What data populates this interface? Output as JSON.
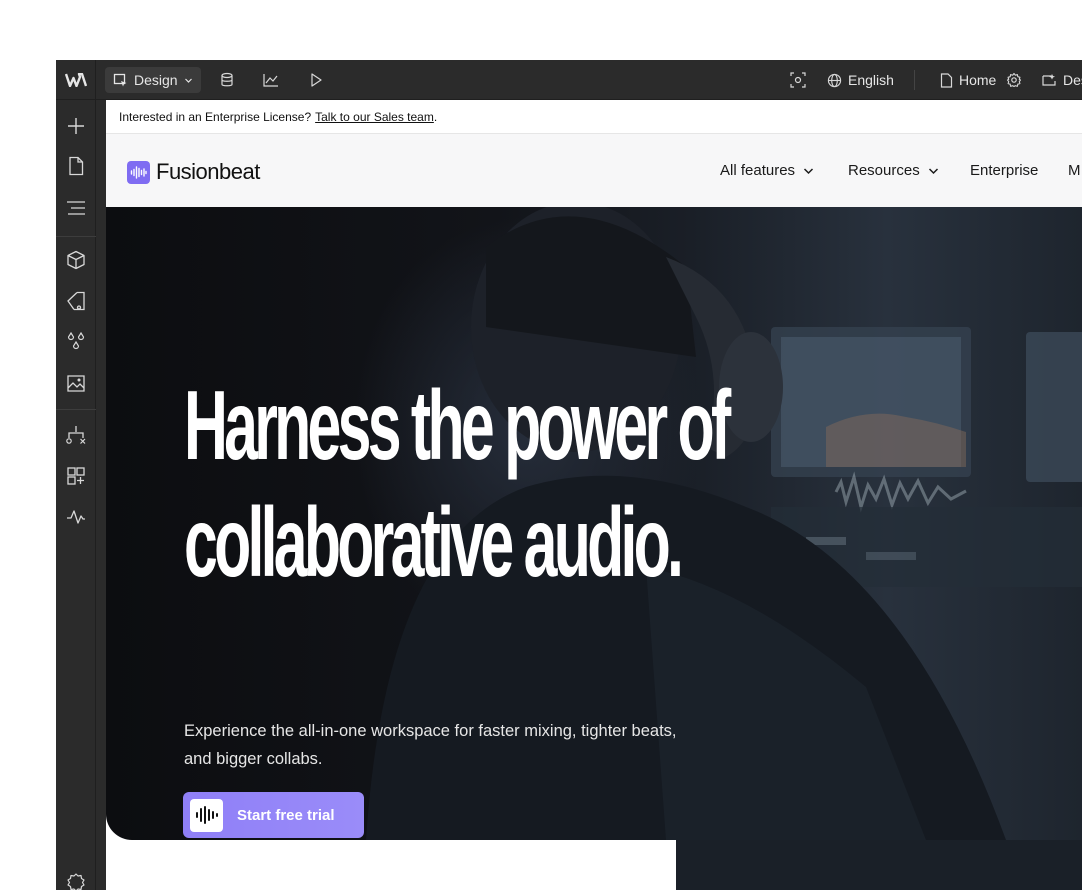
{
  "editor": {
    "mode_label": "Design",
    "locale_label": "English",
    "page_label": "Home",
    "device_label": "Des"
  },
  "site": {
    "announcement_text": "Interested in an Enterprise License?",
    "announcement_link": "Talk to our Sales team",
    "announcement_period": ".",
    "brand_name": "Fusionbeat",
    "nav_items": [
      "All features",
      "Resources",
      "Enterprise",
      "M"
    ],
    "hero_title_line1": "Harness the power of",
    "hero_title_line2": "collaborative audio.",
    "hero_subtitle": "Experience the all-in-one workspace for faster mixing, tighter beats, and bigger collabs.",
    "cta_label": "Start free trial"
  },
  "colors": {
    "chrome": "#2b2b2b",
    "accent": "#8f7ff7",
    "brand_mark": "#7f6cf2"
  },
  "icons": {
    "sidebar": [
      "add-icon",
      "pages-icon",
      "navigator-icon",
      "components-icon",
      "styles-icon",
      "variables-icon",
      "assets-icon",
      "logic-icon",
      "apps-icon",
      "activity-icon",
      "settings-icon"
    ],
    "topbar": [
      "webflow-logo-icon",
      "design-mode-icon",
      "cms-icon",
      "analytics-icon",
      "preview-icon",
      "focus-icon",
      "globe-icon",
      "page-icon",
      "gear-icon",
      "device-icon"
    ]
  }
}
